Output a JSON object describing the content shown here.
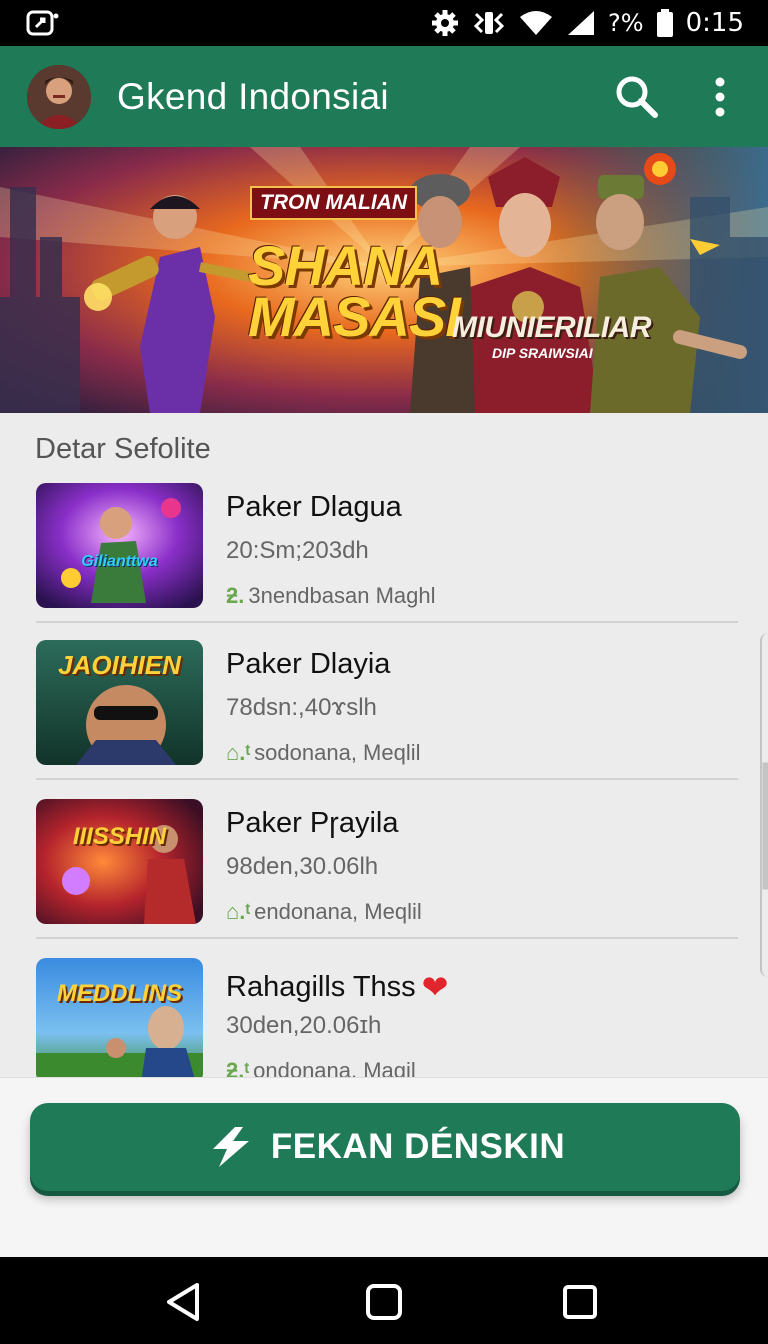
{
  "status_bar": {
    "time": "0:15",
    "battery_text": "%",
    "battery_prefix": "?"
  },
  "app_bar": {
    "title": "Gkend Indonsiai"
  },
  "banner": {
    "tag": "TRON MALIAN",
    "headline_line1": "SHANA",
    "headline_line2": "MASASI",
    "sub_title": "MIUNIERILIAR",
    "sub_caption": "DIP SRAIWSIAI"
  },
  "list": {
    "section_title": "Detar Sefolite",
    "items": [
      {
        "title": "Paker Dlagua",
        "meta": "20:Sm;203dh",
        "sub_icon": "ƻ.",
        "sub": "3nendbasan  Maghl",
        "thumb_text": "Gilianttwa",
        "heart": ""
      },
      {
        "title": "Paker Dlayia",
        "meta": "78dsn:,40ɤslh",
        "sub_icon": "⌂.ᵗ",
        "sub": "sodonana, Meqlil",
        "thumb_text": "JAOIHIEN",
        "heart": ""
      },
      {
        "title": "Paker Pɼayila",
        "meta": "98den,30.06lh",
        "sub_icon": "⌂.ᵗ",
        "sub": "endonana, Meqlil",
        "thumb_text": "IIISSHIN",
        "heart": ""
      },
      {
        "title": "Rahagills Thss",
        "meta": "30den,20.06ɪh",
        "sub_icon": "ƻ.ᵗ",
        "sub": "ondonana, Magil",
        "thumb_text": "MEDDLINS",
        "heart": "❤"
      }
    ]
  },
  "cta": {
    "label": "FEKAN DÉNSKIN"
  },
  "colors": {
    "brand_green": "#1f7a57",
    "accent_red": "#e0262c"
  },
  "icons": {
    "notification": "notification-icon",
    "settings": "gear-icon",
    "wifi": "wifi-icon",
    "signal": "signal-icon",
    "battery": "battery-icon",
    "search": "search-icon",
    "more": "more-vert-icon",
    "cta": "flash-icon",
    "nav_back": "back-icon",
    "nav_home": "home-icon",
    "nav_recents": "recents-icon"
  }
}
